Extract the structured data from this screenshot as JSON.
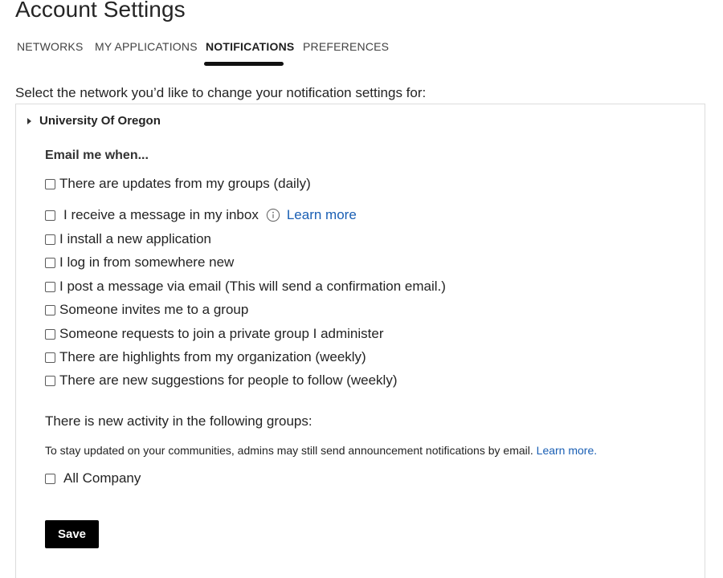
{
  "page": {
    "title": "Account Settings"
  },
  "tabs": [
    {
      "label": "NETWORKS",
      "active": false
    },
    {
      "label": "MY APPLICATIONS",
      "active": false
    },
    {
      "label": "NOTIFICATIONS",
      "active": true
    },
    {
      "label": "PREFERENCES",
      "active": false
    }
  ],
  "instruction": "Select the network you’d like to change your notification settings for:",
  "network": {
    "name": "University Of Oregon",
    "expanded": true
  },
  "email_section": {
    "heading": "Email me when...",
    "options": [
      {
        "label": "There are updates from my groups (daily)",
        "checked": false
      },
      {
        "label": "I receive a message in my inbox",
        "checked": false,
        "info_icon": "info-icon",
        "link": "Learn more"
      },
      {
        "label": "I install a new application",
        "checked": false
      },
      {
        "label": "I log in from somewhere new",
        "checked": false
      },
      {
        "label": "I post a message via email (This will send a confirmation email.)",
        "checked": false
      },
      {
        "label": "Someone invites me to a group",
        "checked": false
      },
      {
        "label": "Someone requests to join a private group I administer",
        "checked": false
      },
      {
        "label": "There are highlights from my organization (weekly)",
        "checked": false
      },
      {
        "label": "There are new suggestions for people to follow (weekly)",
        "checked": false
      }
    ]
  },
  "groups_section": {
    "heading": "There is new activity in the following groups:",
    "note": "To stay updated on your communities, admins may still send announcement notifications by email.",
    "note_link": "Learn more.",
    "groups": [
      {
        "label": "All Company",
        "checked": false
      }
    ]
  },
  "save_label": "Save",
  "colors": {
    "link": "#1a5fb4",
    "button_bg": "#000000",
    "tab_underline": "#111111"
  }
}
